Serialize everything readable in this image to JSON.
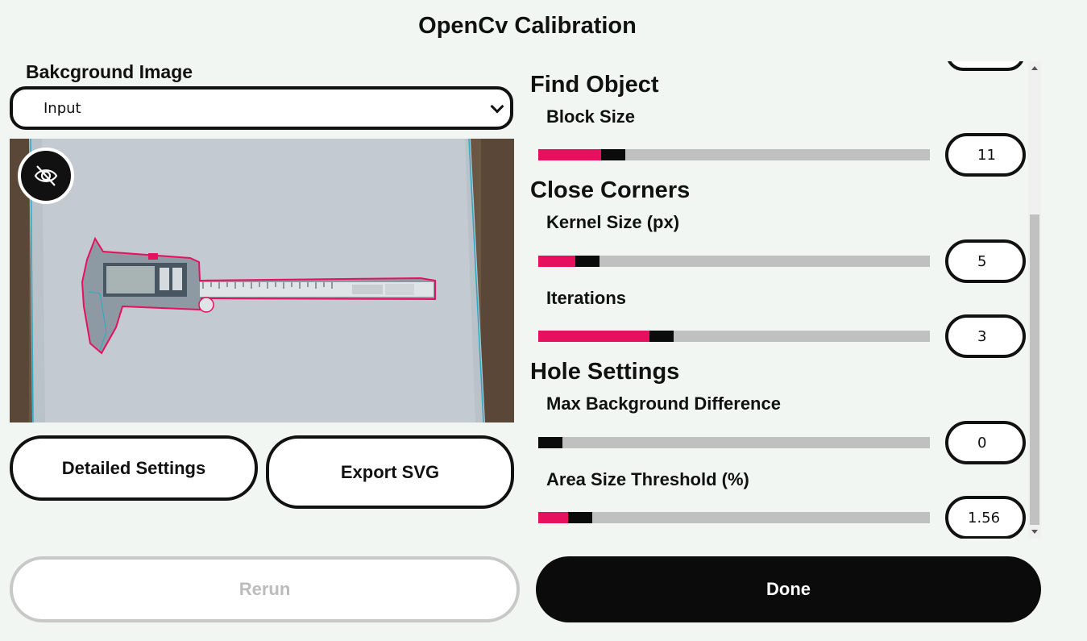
{
  "window": {
    "title": "OpenCv Calibration"
  },
  "background": {
    "label": "Bakcground Image",
    "selected": "Input"
  },
  "preview": {
    "visibility_icon": "eye-off-icon"
  },
  "buttons": {
    "detailed_settings": "Detailed Settings",
    "export_svg": "Export SVG",
    "rerun": "Rerun",
    "done": "Done"
  },
  "settings": {
    "find_object": {
      "title": "Find Object",
      "block_size": {
        "label": "Block Size",
        "value": "11",
        "level": 0.22
      }
    },
    "close_corners": {
      "title": "Close Corners",
      "kernel_size": {
        "label": "Kernel Size (px)",
        "value": "5",
        "level": 0.15
      },
      "iterations": {
        "label": "Iterations",
        "value": "3",
        "level": 0.31
      }
    },
    "hole_settings": {
      "title": "Hole Settings",
      "max_bg_diff": {
        "label": "Max Background Difference",
        "value": "0",
        "level": 0.03
      },
      "area_threshold": {
        "label": "Area Size Threshold (%)",
        "value": "1.56",
        "level": 0.11
      }
    }
  },
  "colors": {
    "accent": "#e6105e",
    "dark": "#0b0b0b",
    "track": "#c0c0c0",
    "background": "#f2f6f3"
  }
}
